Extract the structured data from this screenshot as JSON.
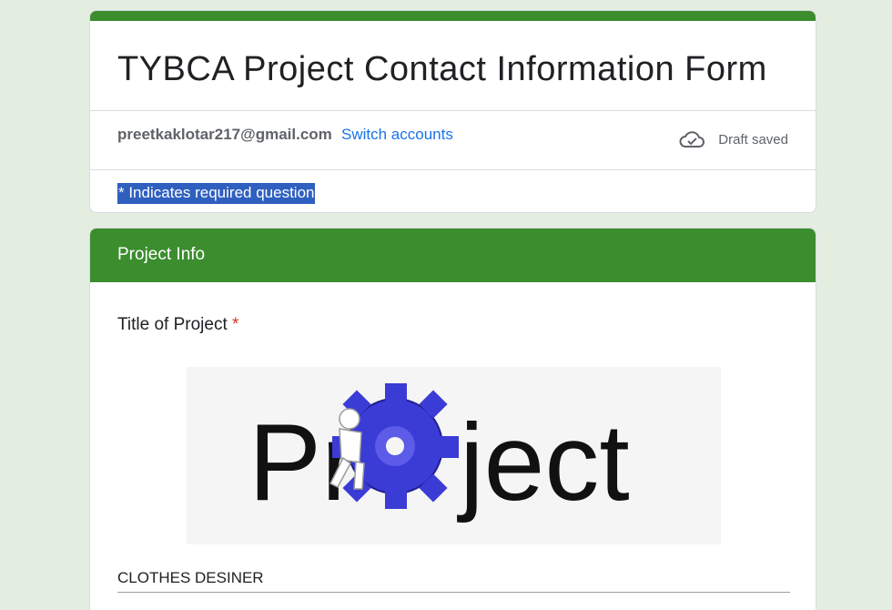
{
  "form": {
    "title": "TYBCA Project Contact Information Form",
    "email": "preetkaklotar217@gmail.com",
    "switch_accounts": "Switch accounts",
    "draft_status": "Draft saved",
    "draft_icon": "cloud-check-icon",
    "required_note": "* Indicates required question",
    "accent_color": "#3b8d2e"
  },
  "section": {
    "title": "Project Info",
    "question": {
      "label": "Title of Project",
      "required_mark": "*",
      "image_text": "Project",
      "answer": "CLOTHES DESINER"
    }
  }
}
